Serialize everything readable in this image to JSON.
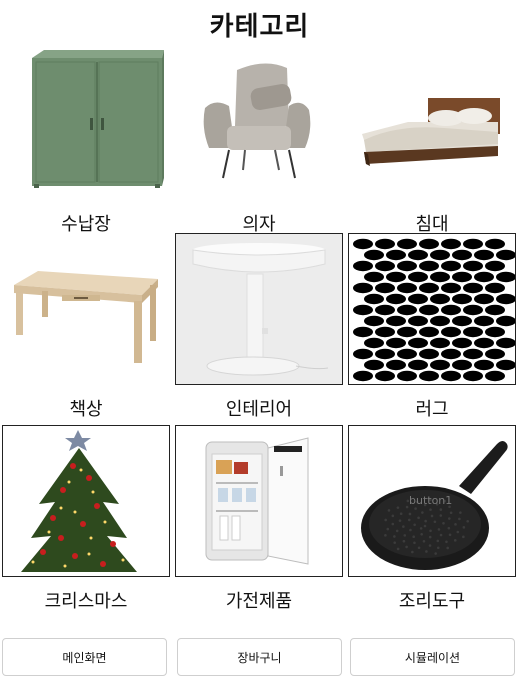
{
  "page": {
    "title": "카테고리"
  },
  "categories": [
    {
      "label": "수납장",
      "icon": "cabinet-image"
    },
    {
      "label": "의자",
      "icon": "armchair-image"
    },
    {
      "label": "침대",
      "icon": "bed-image"
    },
    {
      "label": "책상",
      "icon": "desk-image"
    },
    {
      "label": "인테리어",
      "icon": "table-lamp-image"
    },
    {
      "label": "러그",
      "icon": "dotted-rug-image"
    },
    {
      "label": "크리스마스",
      "icon": "christmas-tree-image"
    },
    {
      "label": "가전제품",
      "icon": "mini-fridge-image"
    },
    {
      "label": "조리도구",
      "icon": "frying-pan-image"
    }
  ],
  "pan_overlay_text": "button1",
  "nav": {
    "main": "메인화면",
    "cart": "장바구니",
    "simulation": "시뮬레이션"
  },
  "colors": {
    "cabinet": "#6f8e6f",
    "rug_dot": "#000000",
    "background": "#ffffff"
  }
}
